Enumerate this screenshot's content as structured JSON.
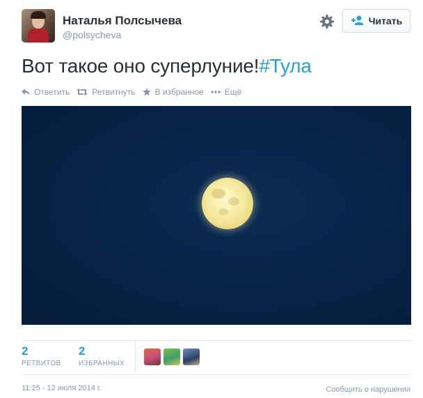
{
  "author": {
    "name": "Наталья Полсычева",
    "handle": "@polsycheva"
  },
  "follow_button": {
    "label": "Читать",
    "icon": "add-user-icon"
  },
  "settings_icon": "gear-icon",
  "tweet": {
    "text": "Вот такое оно суперлуние!",
    "hashtag": "#Тула"
  },
  "actions": [
    {
      "label": "Ответить",
      "icon": "reply-icon"
    },
    {
      "label": "Ретвитнуть",
      "icon": "retweet-icon"
    },
    {
      "label": "В избранное",
      "icon": "star-icon"
    },
    {
      "label": "Ещё",
      "icon": "more-icon"
    }
  ],
  "stats": {
    "retweets": {
      "count": "2",
      "label": "РЕТВИТОВ"
    },
    "favorites": {
      "count": "2",
      "label": "ИЗБРАННЫХ"
    }
  },
  "meta": {
    "timestamp": "11:25 - 12 июля 2014 г.",
    "report": "Сообщить о нарушении"
  },
  "colors": {
    "link": "#2aa1d3",
    "muted": "#8899a6",
    "text": "#292f33",
    "sky": "#072347",
    "moon": "#f6ea9f"
  }
}
